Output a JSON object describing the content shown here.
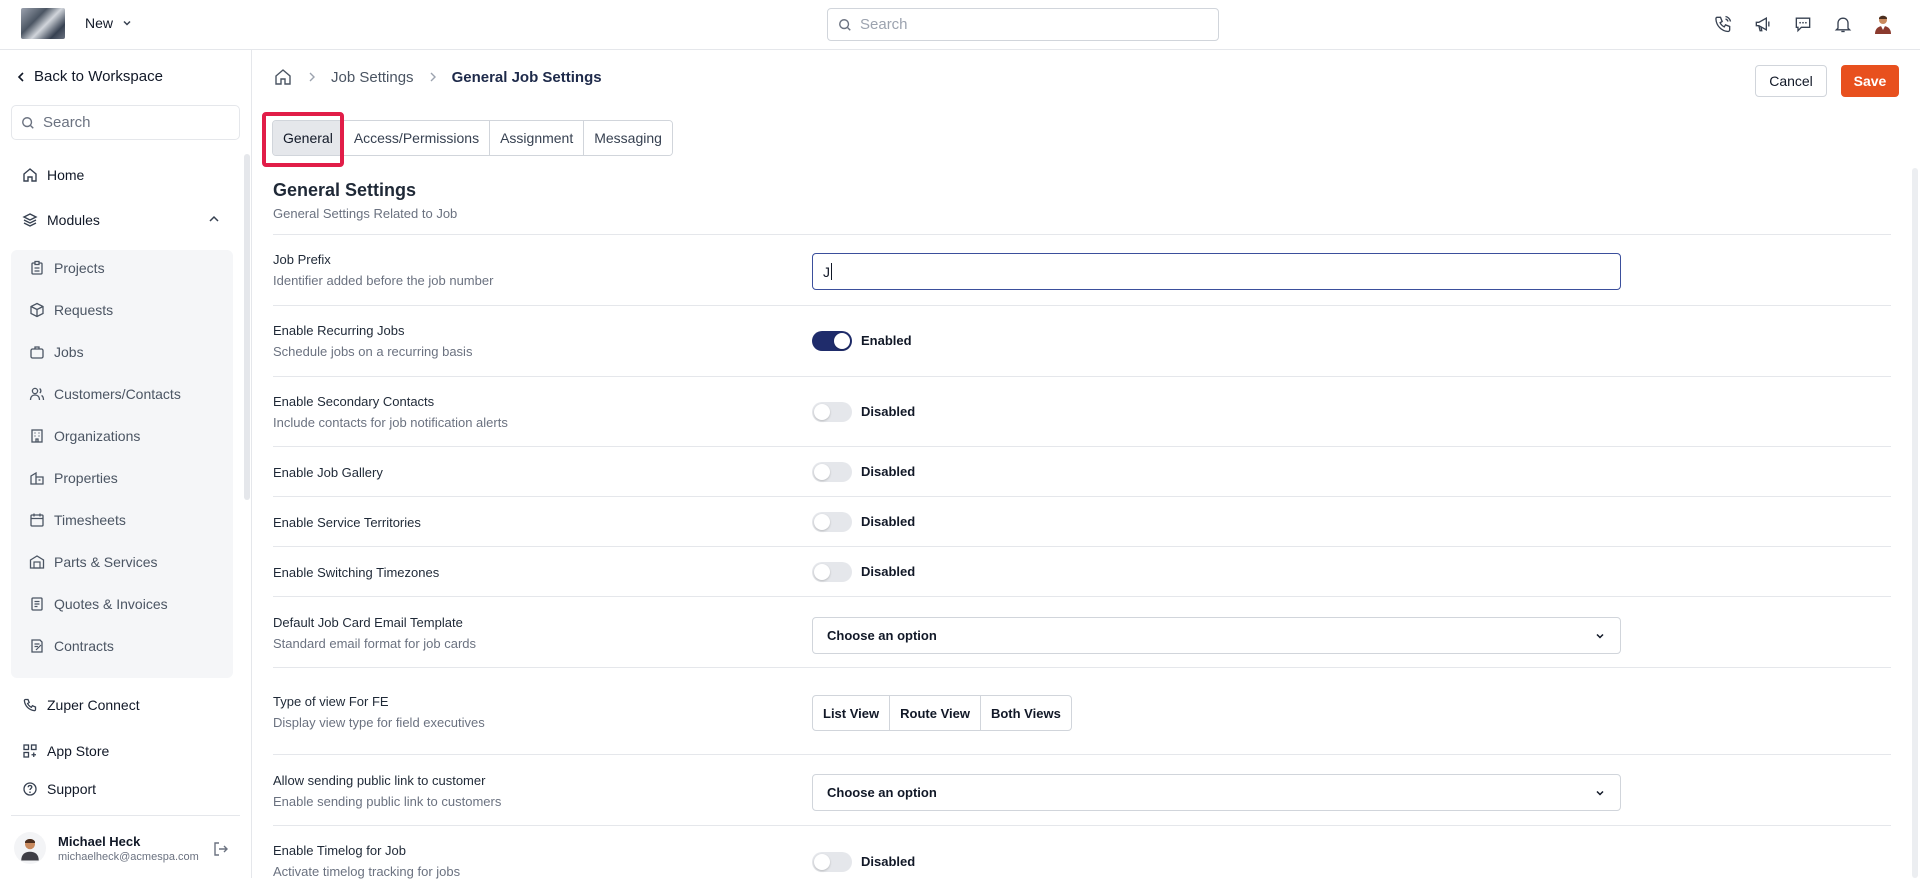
{
  "topbar": {
    "new_label": "New",
    "search_placeholder": "Search"
  },
  "sidebar": {
    "back_label": "Back to Workspace",
    "search_placeholder": "Search",
    "home_label": "Home",
    "modules_label": "Modules",
    "submenu": [
      "Projects",
      "Requests",
      "Jobs",
      "Customers/Contacts",
      "Organizations",
      "Properties",
      "Timesheets",
      "Parts & Services",
      "Quotes & Invoices",
      "Contracts"
    ],
    "bottom_items": [
      "Zuper Connect",
      "App Store",
      "Support"
    ],
    "user": {
      "name": "Michael Heck",
      "email": "michaelheck@acmespa.com"
    }
  },
  "breadcrumb": {
    "parent": "Job Settings",
    "current": "General Job Settings"
  },
  "actions": {
    "cancel": "Cancel",
    "save": "Save"
  },
  "tabs": [
    "General",
    "Access/Permissions",
    "Assignment",
    "Messaging"
  ],
  "section": {
    "title": "General Settings",
    "subtitle": "General Settings Related to Job"
  },
  "settings": {
    "job_prefix": {
      "label": "Job Prefix",
      "desc": "Identifier added before the job number",
      "value": "J"
    },
    "recurring": {
      "label": "Enable Recurring Jobs",
      "desc": "Schedule jobs on a recurring basis",
      "state": "Enabled"
    },
    "secondary_contacts": {
      "label": "Enable Secondary Contacts",
      "desc": "Include contacts for job notification alerts",
      "state": "Disabled"
    },
    "gallery": {
      "label": "Enable Job Gallery",
      "state": "Disabled"
    },
    "territories": {
      "label": "Enable Service Territories",
      "state": "Disabled"
    },
    "timezones": {
      "label": "Enable Switching Timezones",
      "state": "Disabled"
    },
    "email_template": {
      "label": "Default Job Card Email Template",
      "desc": "Standard email format for job cards",
      "value": "Choose an option"
    },
    "fe_view": {
      "label": "Type of view For FE",
      "desc": "Display view type for field executives",
      "options": [
        "List View",
        "Route View",
        "Both Views"
      ]
    },
    "public_link": {
      "label": "Allow sending public link to customer",
      "desc": "Enable sending public link to customers",
      "value": "Choose an option"
    },
    "timelog": {
      "label": "Enable Timelog for Job",
      "desc": "Activate timelog tracking for jobs",
      "state": "Disabled"
    }
  },
  "colors": {
    "accent": "#1f2c6b",
    "save": "#e8501e",
    "highlight": "#e11d48"
  }
}
